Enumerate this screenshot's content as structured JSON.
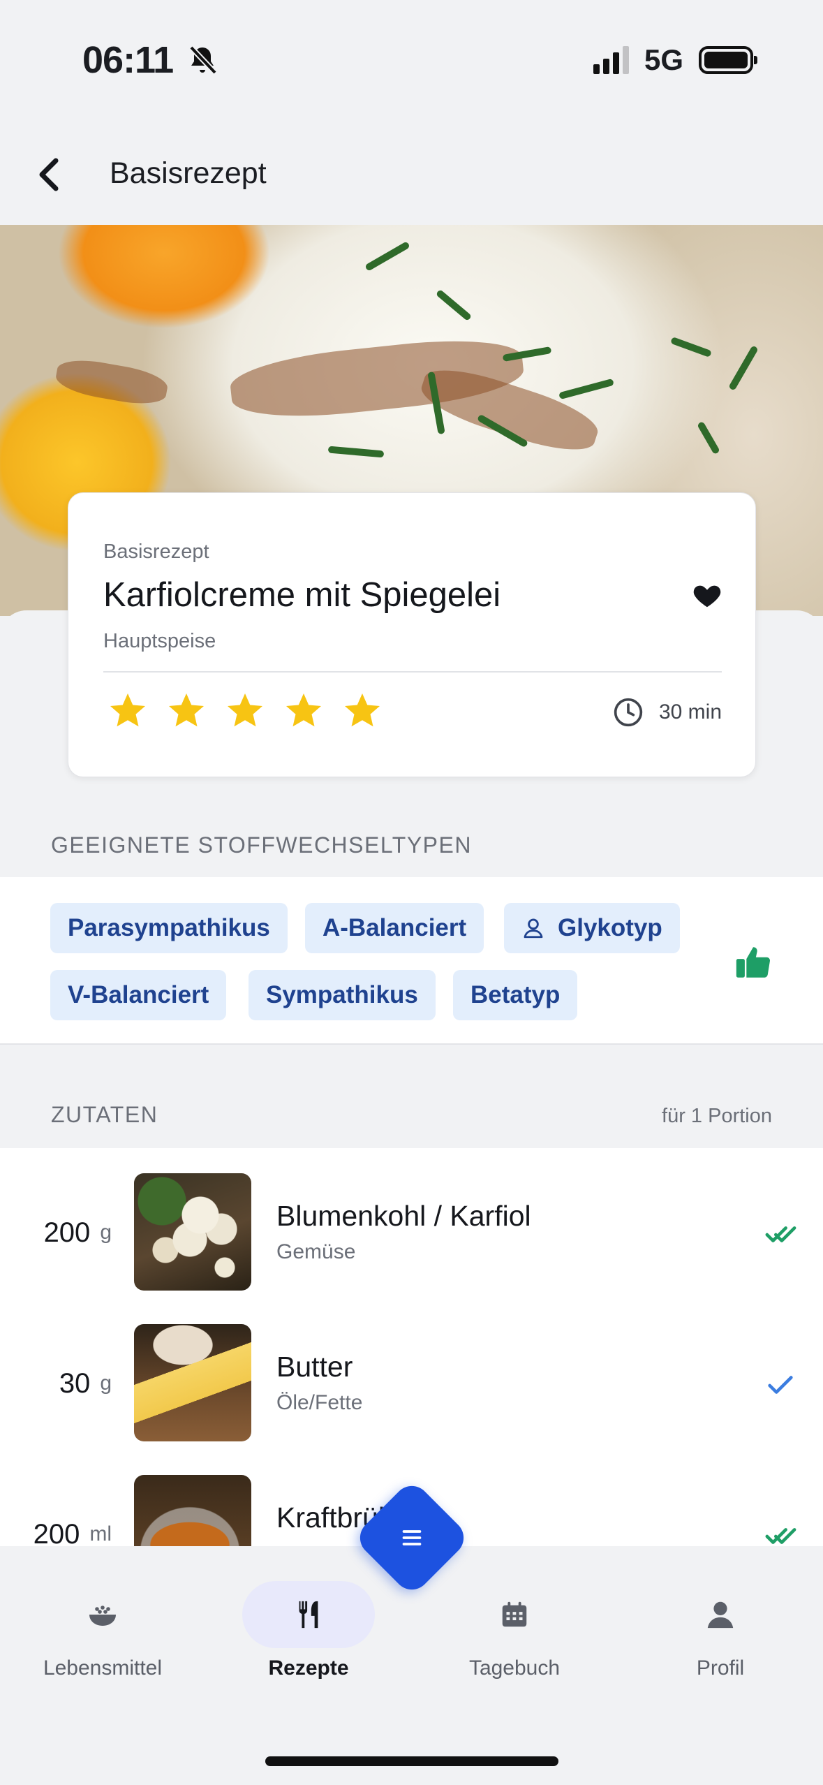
{
  "status_bar": {
    "time": "06:11",
    "network": "5G"
  },
  "header": {
    "title": "Basisrezept"
  },
  "recipe": {
    "kicker": "Basisrezept",
    "title": "Karfiolcreme mit Spiegelei",
    "category": "Hauptspeise",
    "rating": 5,
    "time": "30 min"
  },
  "stoffwechsel": {
    "label": "GEEIGNETE STOFFWECHSELTYPEN",
    "tags": [
      "Parasympathikus",
      "A-Balanciert",
      "Glykotyp",
      "V-Balanciert",
      "Sympathikus",
      "Betatyp"
    ]
  },
  "zutaten": {
    "label": "ZUTATEN",
    "portion": "für 1 Portion",
    "items": [
      {
        "qty": "200",
        "unit": "g",
        "name": "Blumenkohl / Karfiol",
        "category": "Gemüse",
        "check": "double"
      },
      {
        "qty": "30",
        "unit": "g",
        "name": "Butter",
        "category": "Öle/Fette",
        "check": "single"
      },
      {
        "qty": "200",
        "unit": "ml",
        "name": "Kraftbrühe",
        "category": "",
        "check": "double"
      }
    ]
  },
  "nav": {
    "items": [
      "Lebensmittel",
      "Rezepte",
      "Tagebuch",
      "Profil"
    ],
    "active": "Rezepte"
  },
  "colors": {
    "accent": "#1d52e0",
    "tag_bg": "#e3eefc",
    "tag_text": "#1f428f",
    "star": "#f7c413",
    "check_green": "#1e9e66",
    "check_blue": "#3b7de0"
  }
}
